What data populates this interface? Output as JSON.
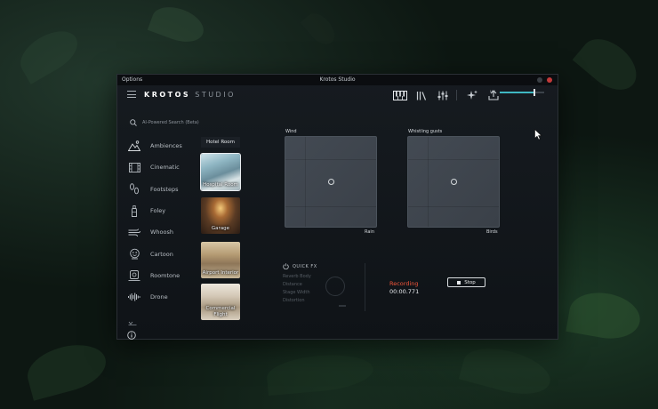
{
  "window": {
    "menu_label": "Options",
    "title": "Krotos Studio"
  },
  "header": {
    "brand_strong": "KROTOS",
    "brand_light": "STUDIO",
    "toolbar_icons": [
      "piano-keys-icon",
      "library-icon",
      "mixer-sliders-icon",
      "sparkle-icon",
      "export-icon"
    ],
    "volume_label": "Vol",
    "volume_level": 0.78
  },
  "search": {
    "placeholder": "AI-Powered Search (Beta)"
  },
  "categories": [
    {
      "label": "Ambiences",
      "icon": "mountain-icon",
      "active": true
    },
    {
      "label": "Cinematic",
      "icon": "film-icon",
      "active": false
    },
    {
      "label": "Footsteps",
      "icon": "footprints-icon",
      "active": false
    },
    {
      "label": "Foley",
      "icon": "bottle-icon",
      "active": false
    },
    {
      "label": "Whoosh",
      "icon": "wind-icon",
      "active": false
    },
    {
      "label": "Cartoon",
      "icon": "cartoon-icon",
      "active": false
    },
    {
      "label": "Roomtone",
      "icon": "speaker-icon",
      "active": false
    },
    {
      "label": "Drone",
      "icon": "waveform-icon",
      "active": false
    }
  ],
  "presets": [
    {
      "label": "Hotel Room",
      "selected": false
    },
    {
      "label": "Hospital Room",
      "selected": true
    },
    {
      "label": "Garage",
      "selected": false
    },
    {
      "label": "Airport Interior",
      "selected": false
    },
    {
      "label": "Commercial Flight",
      "selected": false
    }
  ],
  "pads": [
    {
      "top_label": "Wind",
      "corner_label": "Rain",
      "knob_x": 0.5,
      "knob_y": 0.5
    },
    {
      "top_label": "Whistling gusts",
      "corner_label": "Birds",
      "knob_x": 0.5,
      "knob_y": 0.5
    }
  ],
  "quick_fx": {
    "title": "QUICK FX",
    "rows": [
      "Reverb Body",
      "Distance",
      "Stage Width",
      "Distortion"
    ]
  },
  "recording": {
    "status": "Recording",
    "time": "00:00.771",
    "stop_label": "Stop"
  },
  "colors": {
    "accent": "#3fb7c2",
    "recording": "#f0553a",
    "pad": "#3f464f"
  }
}
